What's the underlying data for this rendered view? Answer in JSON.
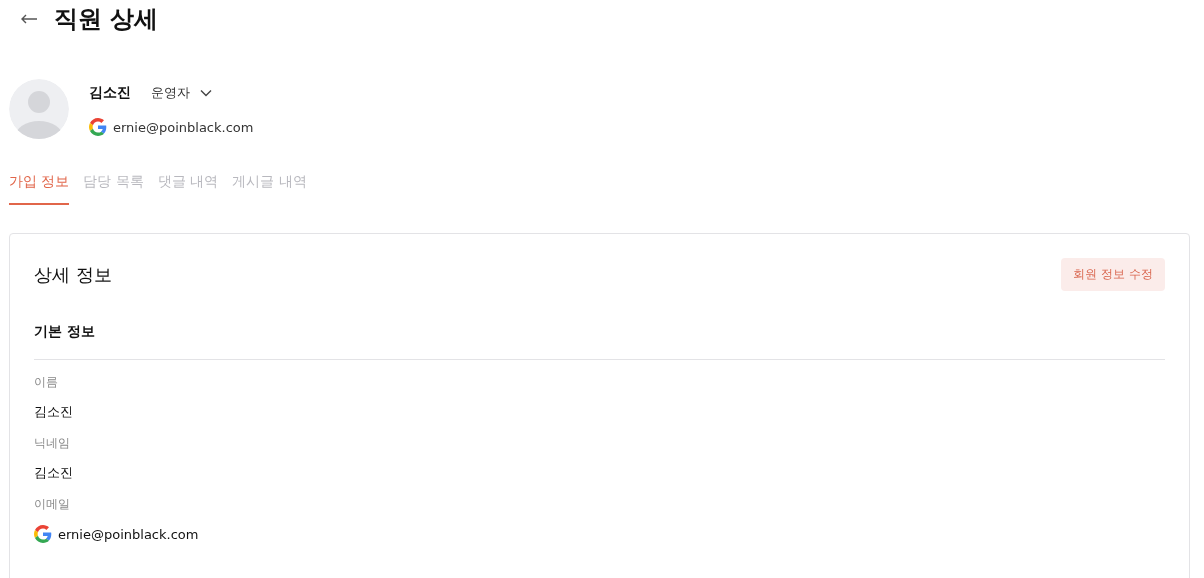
{
  "header": {
    "title": "직원 상세"
  },
  "profile": {
    "name": "김소진",
    "role": "운영자",
    "email": "ernie@poinblack.com"
  },
  "tabs": [
    {
      "label": "가입 정보",
      "selected": true
    },
    {
      "label": "담당 목록",
      "selected": false
    },
    {
      "label": "댓글 내역",
      "selected": false
    },
    {
      "label": "게시글 내역",
      "selected": false
    }
  ],
  "card": {
    "title": "상세 정보",
    "edit_button": "회원 정보 수정",
    "section_title": "기본 정보",
    "fields": [
      {
        "kind": "text",
        "label": "이름",
        "value": "김소진"
      },
      {
        "kind": "text",
        "label": "닉네임",
        "value": "김소진"
      },
      {
        "kind": "google",
        "label": "이메일",
        "value": "ernie@poinblack.com"
      }
    ]
  }
}
